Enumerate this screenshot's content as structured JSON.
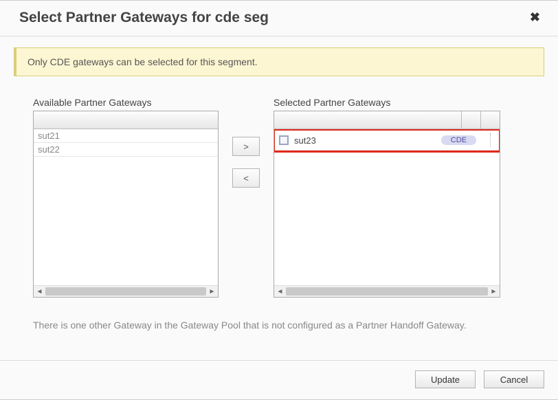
{
  "dialog": {
    "title": "Select Partner Gateways for cde seg",
    "close_label": "✖"
  },
  "notice": {
    "text": "Only CDE gateways can be selected for this segment."
  },
  "available": {
    "label": "Available Partner Gateways",
    "items": [
      "sut21",
      "sut22"
    ]
  },
  "transfer": {
    "add_label": ">",
    "remove_label": "<"
  },
  "selected": {
    "label": "Selected Partner Gateways",
    "items": [
      {
        "name": "sut23",
        "badge": "CDE"
      }
    ]
  },
  "footer_note": "There is one other Gateway in the Gateway Pool that is not configured as a Partner Handoff Gateway.",
  "buttons": {
    "update": "Update",
    "cancel": "Cancel"
  },
  "scrollbar": {
    "left_arrow": "◄",
    "right_arrow": "►"
  }
}
